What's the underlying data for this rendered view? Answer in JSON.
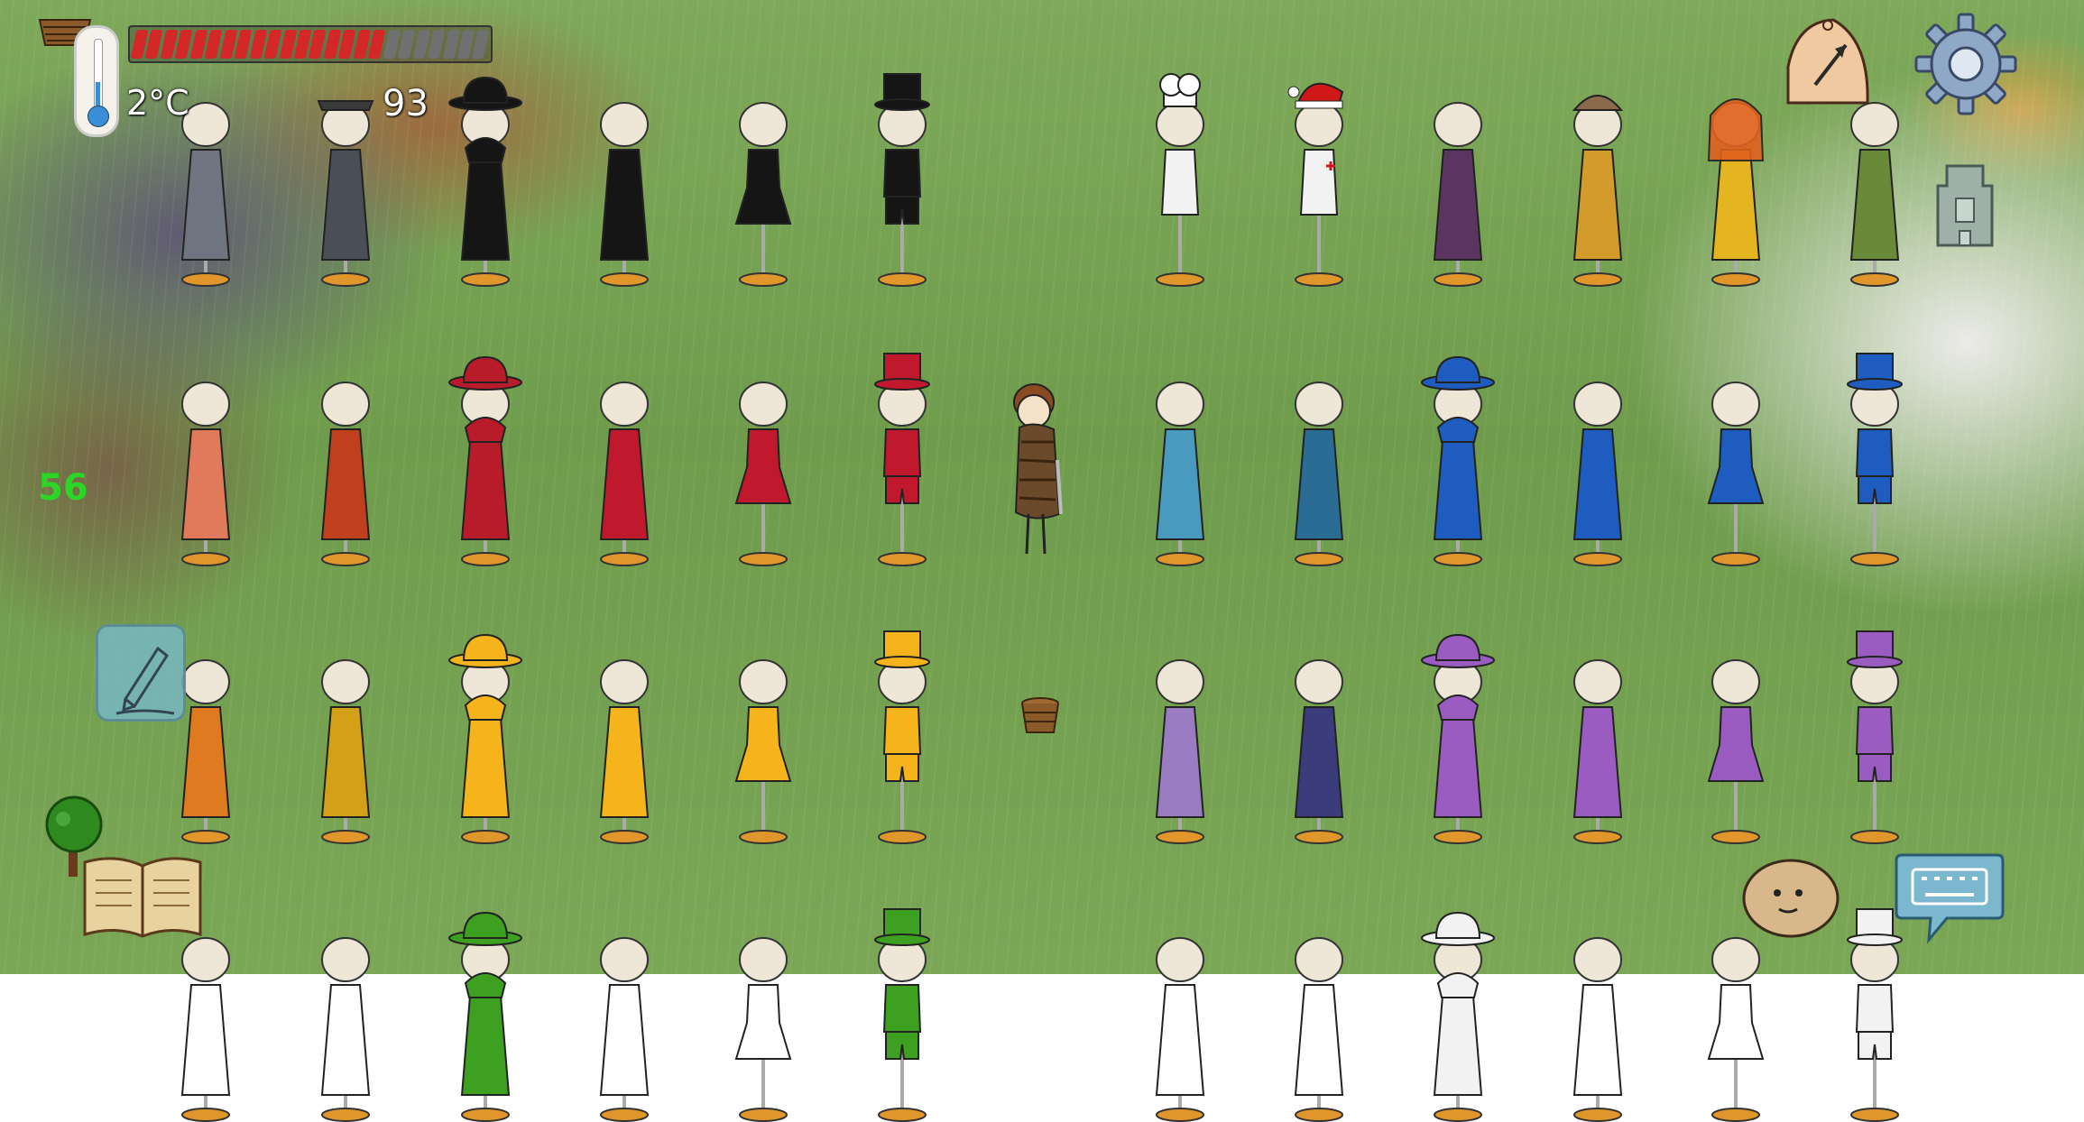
{
  "hud": {
    "temperature": "2°C",
    "yum_counter": "93",
    "fps_counter": "56",
    "food_meter": {
      "filled": 17,
      "total": 24
    },
    "colors": {
      "food_fill": "#d42828",
      "food_empty": "#707070",
      "fps_text": "#2bd626"
    }
  },
  "icons": {
    "thermometer": "thermometer-icon",
    "pencil": "pencil-icon",
    "book": "recipe-book-icon",
    "compass": "compass-icon",
    "settings": "gear-icon",
    "tower": "tower-icon",
    "emote": "potato-face-emote-icon",
    "keyboard": "keyboard-chat-icon"
  },
  "mannequins": [
    {
      "hat": "none",
      "outfit": "robe",
      "color": "#6e7480"
    },
    {
      "hat": "bandana",
      "outfit": "robe",
      "color": "#4a4e56"
    },
    {
      "hat": "bowler",
      "outfit": "hooded-robe",
      "color": "#151515"
    },
    {
      "hat": "none",
      "outfit": "long-dress",
      "color": "#151515"
    },
    {
      "hat": "none",
      "outfit": "short-dress",
      "color": "#151515"
    },
    {
      "hat": "top-hat",
      "outfit": "shirt-shorts",
      "color": "#151515"
    },
    {
      "hat": "none",
      "outfit": "empty",
      "color": "#000000"
    },
    {
      "hat": "chef",
      "outfit": "apron",
      "color": "#f2f2f2"
    },
    {
      "hat": "santa",
      "outfit": "nurse-apron",
      "color": "#f2f2f2"
    },
    {
      "hat": "none",
      "outfit": "tunic",
      "color": "#5a3560"
    },
    {
      "hat": "fur-cap",
      "outfit": "ethnic-robe",
      "color": "#d39a2c"
    },
    {
      "hat": "veil",
      "outfit": "ethnic-dress",
      "color": "#e5b521"
    },
    {
      "hat": "none",
      "outfit": "ethnic-robe",
      "color": "#6a8a3a"
    },
    {
      "hat": "none",
      "outfit": "robe",
      "color": "#e07a5a"
    },
    {
      "hat": "none",
      "outfit": "robe",
      "color": "#c0401e"
    },
    {
      "hat": "bowler",
      "outfit": "hooded-robe",
      "color": "#b81c2a"
    },
    {
      "hat": "none",
      "outfit": "long-dress",
      "color": "#c0182c"
    },
    {
      "hat": "none",
      "outfit": "short-dress",
      "color": "#c0182c"
    },
    {
      "hat": "top-hat",
      "outfit": "shirt-shorts",
      "color": "#c0182c"
    },
    {
      "hat": "none",
      "outfit": "empty",
      "color": "#000000"
    },
    {
      "hat": "none",
      "outfit": "robe",
      "color": "#4a9ac0"
    },
    {
      "hat": "none",
      "outfit": "robe",
      "color": "#2a6c94"
    },
    {
      "hat": "bowler",
      "outfit": "hooded-robe",
      "color": "#1e5cc0"
    },
    {
      "hat": "none",
      "outfit": "long-dress",
      "color": "#1e5cc0"
    },
    {
      "hat": "none",
      "outfit": "short-dress",
      "color": "#1e5cc0"
    },
    {
      "hat": "top-hat",
      "outfit": "shirt-shorts",
      "color": "#1e5cc0"
    },
    {
      "hat": "none",
      "outfit": "robe",
      "color": "#e07a20"
    },
    {
      "hat": "none",
      "outfit": "robe",
      "color": "#d4a018"
    },
    {
      "hat": "bowler",
      "outfit": "hooded-robe",
      "color": "#f5b41c"
    },
    {
      "hat": "none",
      "outfit": "long-dress",
      "color": "#f5b41c"
    },
    {
      "hat": "none",
      "outfit": "short-dress",
      "color": "#f5b41c"
    },
    {
      "hat": "top-hat",
      "outfit": "shirt-shorts",
      "color": "#f5b41c"
    },
    {
      "hat": "none",
      "outfit": "empty",
      "color": "#000000"
    },
    {
      "hat": "none",
      "outfit": "robe",
      "color": "#9a7cc0"
    },
    {
      "hat": "none",
      "outfit": "robe",
      "color": "#3a3c7c"
    },
    {
      "hat": "bowler",
      "outfit": "hooded-robe",
      "color": "#9a5cc0"
    },
    {
      "hat": "none",
      "outfit": "long-dress",
      "color": "#9a5cc0"
    },
    {
      "hat": "none",
      "outfit": "short-dress",
      "color": "#9a5cc0"
    },
    {
      "hat": "top-hat",
      "outfit": "shirt-shorts",
      "color": "#9a5cc0"
    },
    {
      "hat": "none",
      "outfit": "robe",
      "color": "#ffffff"
    },
    {
      "hat": "none",
      "outfit": "robe",
      "color": "#ffffff"
    },
    {
      "hat": "bowler",
      "outfit": "hooded-robe",
      "color": "#3ea020"
    },
    {
      "hat": "none",
      "outfit": "long-dress",
      "color": "#ffffff"
    },
    {
      "hat": "none",
      "outfit": "short-dress",
      "color": "#ffffff"
    },
    {
      "hat": "top-hat",
      "outfit": "shirt-shorts",
      "color": "#3ea020"
    },
    {
      "hat": "none",
      "outfit": "empty",
      "color": "#000000"
    },
    {
      "hat": "none",
      "outfit": "robe",
      "color": "#ffffff"
    },
    {
      "hat": "none",
      "outfit": "robe",
      "color": "#ffffff"
    },
    {
      "hat": "bowler",
      "outfit": "hooded-robe",
      "color": "#f2f2f2"
    },
    {
      "hat": "none",
      "outfit": "long-dress",
      "color": "#ffffff"
    },
    {
      "hat": "none",
      "outfit": "short-dress",
      "color": "#ffffff"
    },
    {
      "hat": "top-hat",
      "outfit": "shirt-shorts",
      "color": "#f2f2f2"
    }
  ],
  "player": {
    "outfit": "fur-coat",
    "hair_color": "#8a4a22"
  }
}
